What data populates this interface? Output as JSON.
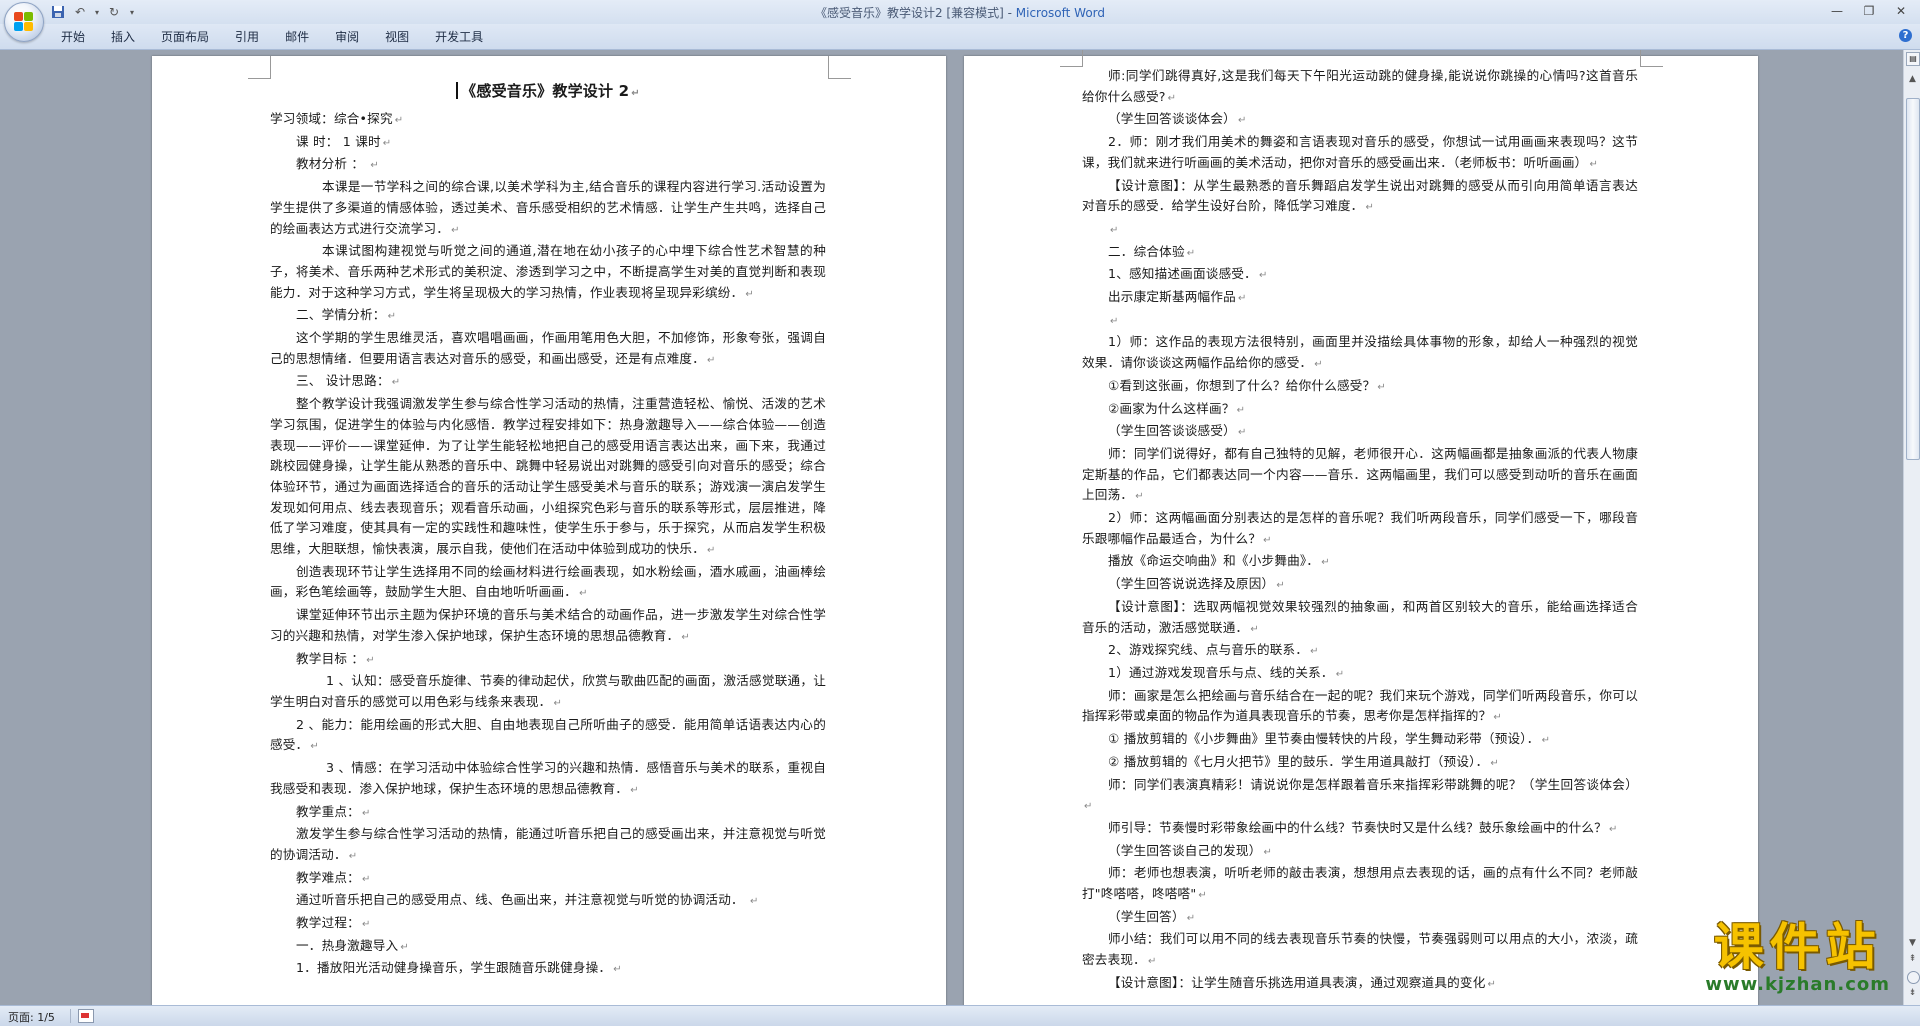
{
  "window": {
    "title_doc": "《感受音乐》教学设计2 [兼容模式] - ",
    "title_app": "Microsoft Word"
  },
  "ribbon": {
    "tabs": [
      "开始",
      "插入",
      "页面布局",
      "引用",
      "邮件",
      "审阅",
      "视图",
      "开发工具"
    ]
  },
  "page1": {
    "title": "《感受音乐》教学设计 2",
    "paragraphs": [
      {
        "indent": 0,
        "text": "学习领域：综合•探究"
      },
      {
        "indent": 1,
        "text": "课   时：  1 课时"
      },
      {
        "indent": 1,
        "text": "教材分析 ：  "
      },
      {
        "indent": 2,
        "text": "本课是一节学科之间的综合课,以美术学科为主,结合音乐的课程内容进行学习.活动设置为学生提供了多渠道的情感体验，透过美术、音乐感受相织的艺术情感．让学生产生共鸣，选择自己的绘画表达方式进行交流学习．"
      },
      {
        "indent": 2,
        "text": "本课试图构建视觉与听觉之间的通道,潜在地在幼小孩子的心中埋下综合性艺术智慧的种子，将美术、音乐两种艺术形式的美积淀、渗透到学习之中，不断提高学生对美的直觉判断和表现能力．对于这种学习方式，学生将呈现极大的学习热情，作业表现将呈现异彩缤纷．"
      },
      {
        "indent": 1,
        "text": "二、学情分析："
      },
      {
        "indent": 1,
        "text": "这个学期的学生思维灵活，喜欢唱唱画画，作画用笔用色大胆，不加修饰，形象夸张，强调自己的思想情绪．但要用语言表达对音乐的感受，和画出感受，还是有点难度．"
      },
      {
        "indent": 1,
        "text": "三、  设计思路："
      },
      {
        "indent": 1,
        "text": "整个教学设计我强调激发学生参与综合性学习活动的热情，注重营造轻松、愉悦、活泼的艺术学习氛围，促进学生的体验与内化感悟．教学过程安排如下：热身激趣导入——综合体验——创造表现——评价——课堂延伸．为了让学生能轻松地把自己的感受用语言表达出来，画下来，我通过跳校园健身操，让学生能从熟悉的音乐中、跳舞中轻易说出对跳舞的感受引向对音乐的感受；综合体验环节，通过为画面选择适合的音乐的活动让学生感受美术与音乐的联系；游戏演一演启发学生发现如何用点、线去表现音乐；观看音乐动画，小组探究色彩与音乐的联系等形式，层层推进，降低了学习难度，使其具有一定的实践性和趣味性，使学生乐于参与，乐于探究，从而启发学生积极思维，大胆联想，愉快表演，展示自我，使他们在活动中体验到成功的快乐．"
      },
      {
        "indent": 1,
        "text": "创造表现环节让学生选择用不同的绘画材料进行绘画表现，如水粉绘画，酒水戚画，油画棒绘画，彩色笔绘画等，鼓励学生大胆、自由地听听画画．"
      },
      {
        "indent": 1,
        "text": "课堂延伸环节出示主题为保护环境的音乐与美术结合的动画作品，进一步激发学生对综合性学习的兴趣和热情，对学生渗入保护地球，保护生态环境的思想品德教育．"
      },
      {
        "indent": 1,
        "text": "教学目标 ："
      },
      {
        "indent": 3,
        "text": "1 、认知：感受音乐旋律、节奏的律动起伏，欣赏与歌曲匹配的画面，激活感觉联通，让学生明白对音乐的感觉可以用色彩与线条来表现．"
      },
      {
        "indent": 1,
        "text": "2 、能力：能用绘画的形式大胆、自由地表现自己所听曲子的感受．能用简单话语表达内心的感受．"
      },
      {
        "indent": 3,
        "text": "3 、情感：在学习活动中体验综合性学习的兴趣和热情．感悟音乐与美术的联系，重视自我感受和表现．渗入保护地球，保护生态环境的思想品德教育．"
      },
      {
        "indent": 1,
        "text": "教学重点："
      },
      {
        "indent": 1,
        "text": "激发学生参与综合性学习活动的热情，能通过听音乐把自己的感受画出来，并注意视觉与听觉的协调活动．"
      },
      {
        "indent": 1,
        "text": "教学难点："
      },
      {
        "indent": 1,
        "text": "通过听音乐把自己的感受用点、线、色画出来，并注意视觉与听觉的协调活动．  "
      },
      {
        "indent": 1,
        "text": "教学过程："
      },
      {
        "indent": 1,
        "text": "一．热身激趣导入"
      },
      {
        "indent": 1,
        "text": "1．播放阳光活动健身操音乐，学生跟随音乐跳健身操．"
      }
    ]
  },
  "page2": {
    "paragraphs": [
      {
        "indent": 1,
        "text": "师:同学们跳得真好,这是我们每天下午阳光运动跳的健身操,能说说你跳操的心情吗?这首音乐给你什么感受?"
      },
      {
        "indent": 1,
        "text": "（学生回答谈谈体会）"
      },
      {
        "indent": 1,
        "text": "2．师：刚才我们用美术的舞姿和言语表现对音乐的感受，你想试一试用画画来表现吗？这节课，我们就来进行听画画的美术活动，把你对音乐的感受画出来．（老师板书：听听画画）"
      },
      {
        "indent": 1,
        "text": "【设计意图】：从学生最熟悉的音乐舞蹈启发学生说出对跳舞的感受从而引向用简单语言表达对音乐的感受．给学生设好台阶，降低学习难度．"
      },
      {
        "indent": 1,
        "text": ""
      },
      {
        "indent": 1,
        "text": "二．综合体验"
      },
      {
        "indent": 1,
        "text": "1、感知描述画面谈感受．"
      },
      {
        "indent": 1,
        "text": "出示康定斯基两幅作品"
      },
      {
        "indent": 1,
        "text": ""
      },
      {
        "indent": 1,
        "text": "1）师：这作品的表现方法很特别，画面里并没描绘具体事物的形象，却给人一种强烈的视觉效果．请你谈谈这两幅作品给你的感受．"
      },
      {
        "indent": 1,
        "text": "①看到这张画，你想到了什么？给你什么感受？"
      },
      {
        "indent": 1,
        "text": "②画家为什么这样画？"
      },
      {
        "indent": 1,
        "text": "（学生回答谈谈感受）"
      },
      {
        "indent": 1,
        "text": "师：同学们说得好，都有自己独特的见解，老师很开心．这两幅画都是抽象画派的代表人物康定斯基的作品，它们都表达同一个内容——音乐．这两幅画里，我们可以感受到动听的音乐在画面上回荡．"
      },
      {
        "indent": 1,
        "text": "2）师：这两幅画面分别表达的是怎样的音乐呢？我们听两段音乐，同学们感受一下，哪段音乐跟哪幅作品最适合，为什么？"
      },
      {
        "indent": 1,
        "text": "播放《命运交响曲》和《小步舞曲》．"
      },
      {
        "indent": 1,
        "text": "（学生回答说说选择及原因）"
      },
      {
        "indent": 1,
        "text": "【设计意图】：选取两幅视觉效果较强烈的抽象画，和两首区别较大的音乐，能给画选择适合音乐的活动，激活感觉联通．"
      },
      {
        "indent": 1,
        "text": "2、游戏探究线、点与音乐的联系．"
      },
      {
        "indent": 1,
        "text": "1）通过游戏发现音乐与点、线的关系．"
      },
      {
        "indent": 1,
        "text": "师：画家是怎么把绘画与音乐结合在一起的呢？我们来玩个游戏，同学们听两段音乐，你可以指挥彩带或桌面的物品作为道具表现音乐的节奏，思考你是怎样指挥的？"
      },
      {
        "indent": 1,
        "text": "① 播放剪辑的《小步舞曲》里节奏由慢转快的片段，学生舞动彩带（预设）．"
      },
      {
        "indent": 1,
        "text": "② 播放剪辑的《七月火把节》里的鼓乐．学生用道具敲打（预设）．"
      },
      {
        "indent": 1,
        "text": "师：同学们表演真精彩！请说说你是怎样跟着音乐来指挥彩带跳舞的呢？（学生回答谈体会）"
      },
      {
        "indent": 1,
        "text": "师引导：节奏慢时彩带象绘画中的什么线？节奏快时又是什么线？鼓乐象绘画中的什么？"
      },
      {
        "indent": 1,
        "text": "（学生回答谈自己的发现）"
      },
      {
        "indent": 1,
        "text": "师：老师也想表演，听听老师的敲击表演，想想用点去表现的话，画的点有什么不同？老师敲打\"咚嗒嗒，咚嗒嗒\""
      },
      {
        "indent": 1,
        "text": "（学生回答）"
      },
      {
        "indent": 1,
        "text": "师小结：我们可以用不同的线去表现音乐节奏的快慢，节奏强弱则可以用点的大小，浓淡，疏密去表现．"
      },
      {
        "indent": 1,
        "text": "【设计意图】：让学生随音乐挑选用道具表演，通过观察道具的变化"
      }
    ]
  },
  "status": {
    "page_label": "页面: 1/5"
  },
  "watermark": {
    "main": "课件站",
    "url": "www.kjzhan.com"
  }
}
